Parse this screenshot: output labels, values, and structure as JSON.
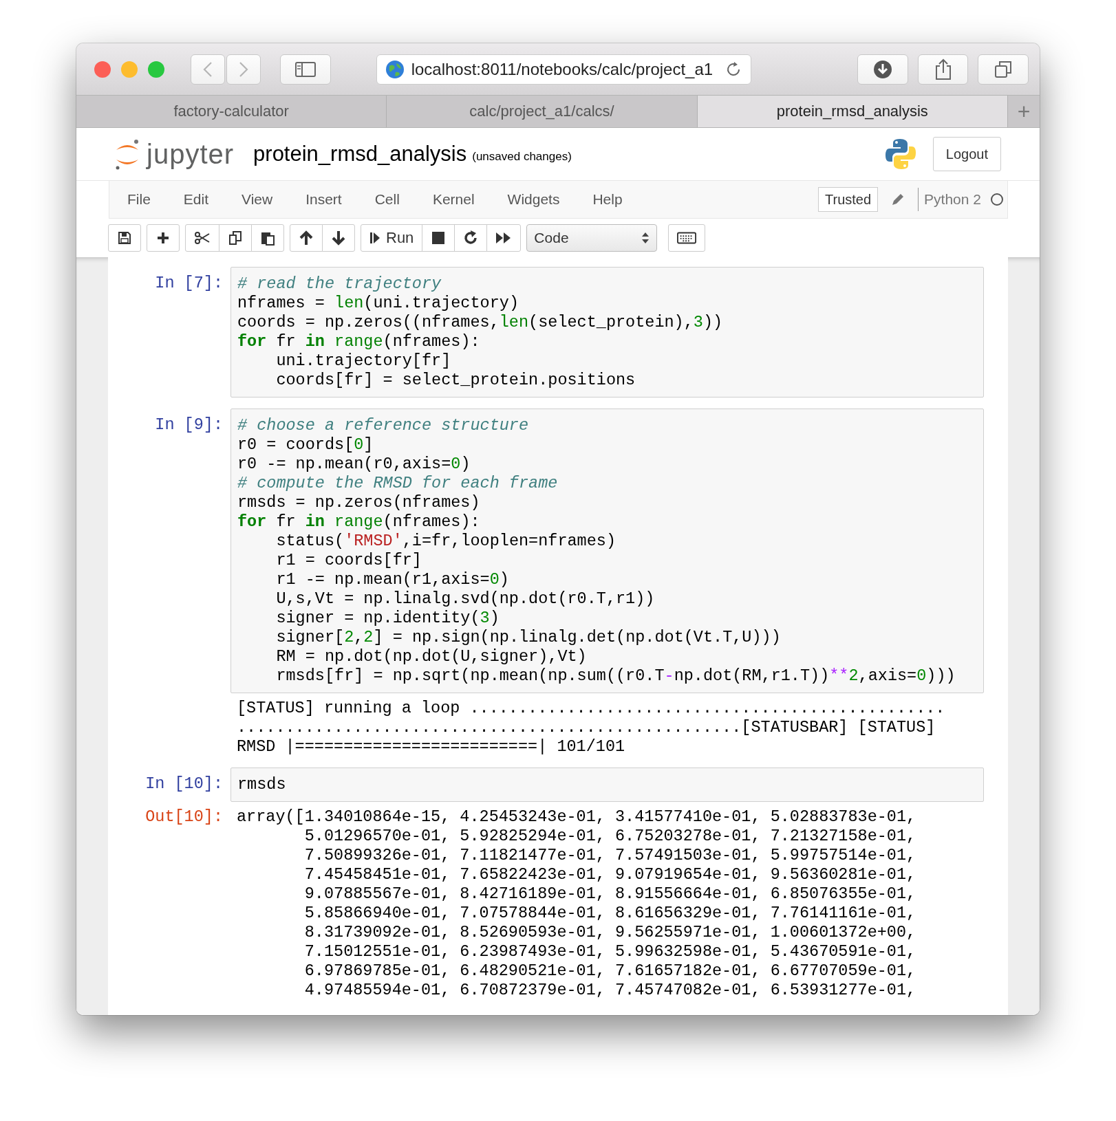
{
  "browser": {
    "url": "localhost:8011/notebooks/calc/project_a1",
    "tabs": [
      {
        "label": "factory-calculator",
        "selected": false
      },
      {
        "label": "calc/project_a1/calcs/",
        "selected": false
      },
      {
        "label": "protein_rmsd_analysis",
        "selected": true
      }
    ],
    "new_tab": "+"
  },
  "header": {
    "logo_text": "jupyter",
    "notebook_name": "protein_rmsd_analysis",
    "save_status": "(unsaved changes)",
    "logout": "Logout"
  },
  "menu": [
    "File",
    "Edit",
    "View",
    "Insert",
    "Cell",
    "Kernel",
    "Widgets",
    "Help"
  ],
  "trusted": "Trusted",
  "kernel": {
    "name": "Python 2",
    "busy": false
  },
  "toolbar": {
    "run": "Run",
    "cell_type": "Code"
  },
  "cells": [
    {
      "prompt": "In [7]:",
      "input": [
        [
          {
            "kind": "comment",
            "text": "# read the trajectory"
          }
        ],
        [
          {
            "kind": "plain",
            "text": "nframes = "
          },
          {
            "kind": "builtin",
            "text": "len"
          },
          {
            "kind": "plain",
            "text": "(uni.trajectory)"
          }
        ],
        [
          {
            "kind": "plain",
            "text": "coords = np.zeros((nframes,"
          },
          {
            "kind": "builtin",
            "text": "len"
          },
          {
            "kind": "plain",
            "text": "(select_protein),"
          },
          {
            "kind": "number",
            "text": "3"
          },
          {
            "kind": "plain",
            "text": "))"
          }
        ],
        [
          {
            "kind": "keyword",
            "text": "for"
          },
          {
            "kind": "plain",
            "text": " fr "
          },
          {
            "kind": "keyword",
            "text": "in"
          },
          {
            "kind": "builtin",
            "text": " range"
          },
          {
            "kind": "plain",
            "text": "(nframes):"
          }
        ],
        [
          {
            "kind": "plain",
            "text": "    uni.trajectory[fr]"
          }
        ],
        [
          {
            "kind": "plain",
            "text": "    coords[fr] = select_protein.positions"
          }
        ]
      ]
    },
    {
      "prompt": "In [9]:",
      "input": [
        [
          {
            "kind": "comment",
            "text": "# choose a reference structure"
          }
        ],
        [
          {
            "kind": "plain",
            "text": "r0 = coords["
          },
          {
            "kind": "number",
            "text": "0"
          },
          {
            "kind": "plain",
            "text": "]"
          }
        ],
        [
          {
            "kind": "plain",
            "text": "r0 -= np.mean(r0,axis="
          },
          {
            "kind": "number",
            "text": "0"
          },
          {
            "kind": "plain",
            "text": ")"
          }
        ],
        [
          {
            "kind": "comment",
            "text": "# compute the RMSD for each frame"
          }
        ],
        [
          {
            "kind": "plain",
            "text": "rmsds = np.zeros(nframes)"
          }
        ],
        [
          {
            "kind": "keyword",
            "text": "for"
          },
          {
            "kind": "plain",
            "text": " fr "
          },
          {
            "kind": "keyword",
            "text": "in"
          },
          {
            "kind": "builtin",
            "text": " range"
          },
          {
            "kind": "plain",
            "text": "(nframes):"
          }
        ],
        [
          {
            "kind": "plain",
            "text": "    status("
          },
          {
            "kind": "string",
            "text": "'RMSD'"
          },
          {
            "kind": "plain",
            "text": ",i=fr,looplen=nframes)"
          }
        ],
        [
          {
            "kind": "plain",
            "text": "    r1 = coords[fr]"
          }
        ],
        [
          {
            "kind": "plain",
            "text": "    r1 -= np.mean(r1,axis="
          },
          {
            "kind": "number",
            "text": "0"
          },
          {
            "kind": "plain",
            "text": ")"
          }
        ],
        [
          {
            "kind": "plain",
            "text": "    U,s,Vt = np.linalg.svd(np.dot(r0.T,r1))"
          }
        ],
        [
          {
            "kind": "plain",
            "text": "    signer = np.identity("
          },
          {
            "kind": "number",
            "text": "3"
          },
          {
            "kind": "plain",
            "text": ")"
          }
        ],
        [
          {
            "kind": "plain",
            "text": "    signer["
          },
          {
            "kind": "number",
            "text": "2"
          },
          {
            "kind": "plain",
            "text": ","
          },
          {
            "kind": "number",
            "text": "2"
          },
          {
            "kind": "plain",
            "text": "] = np.sign(np.linalg.det(np.dot(Vt.T,U)))"
          }
        ],
        [
          {
            "kind": "plain",
            "text": "    RM = np.dot(np.dot(U,signer),Vt)"
          }
        ],
        [
          {
            "kind": "plain",
            "text": "    rmsds[fr] = np.sqrt(np.mean(np.sum((r0.T"
          },
          {
            "kind": "operator",
            "text": "-"
          },
          {
            "kind": "plain",
            "text": "np.dot(RM,r1.T))"
          },
          {
            "kind": "operator",
            "text": "**"
          },
          {
            "kind": "number",
            "text": "2"
          },
          {
            "kind": "plain",
            "text": ",axis="
          },
          {
            "kind": "number",
            "text": "0"
          },
          {
            "kind": "plain",
            "text": ")))"
          }
        ]
      ],
      "output": {
        "kind": "stream",
        "lines": [
          "[STATUS] running a loop .................................................",
          "....................................................[STATUSBAR] [STATUS]",
          "RMSD |=========================| 101/101"
        ]
      }
    },
    {
      "prompt": "In [10]:",
      "input": [
        [
          {
            "kind": "plain",
            "text": "rmsds"
          }
        ]
      ],
      "output": {
        "kind": "result",
        "prompt": "Out[10]:",
        "lines": [
          "array([1.34010864e-15, 4.25453243e-01, 3.41577410e-01, 5.02883783e-01,",
          "       5.01296570e-01, 5.92825294e-01, 6.75203278e-01, 7.21327158e-01,",
          "       7.50899326e-01, 7.11821477e-01, 7.57491503e-01, 5.99757514e-01,",
          "       7.45458451e-01, 7.65822423e-01, 9.07919654e-01, 9.56360281e-01,",
          "       9.07885567e-01, 8.42716189e-01, 8.91556664e-01, 6.85076355e-01,",
          "       5.85866940e-01, 7.07578844e-01, 8.61656329e-01, 7.76141161e-01,",
          "       8.31739092e-01, 8.52690593e-01, 9.56255971e-01, 1.00601372e+00,",
          "       7.15012551e-01, 6.23987493e-01, 5.99632598e-01, 5.43670591e-01,",
          "       6.97869785e-01, 6.48290521e-01, 7.61657182e-01, 6.67707059e-01,",
          "       4.97485594e-01, 6.70872379e-01, 7.45747082e-01, 6.53931277e-01,"
        ]
      }
    }
  ]
}
